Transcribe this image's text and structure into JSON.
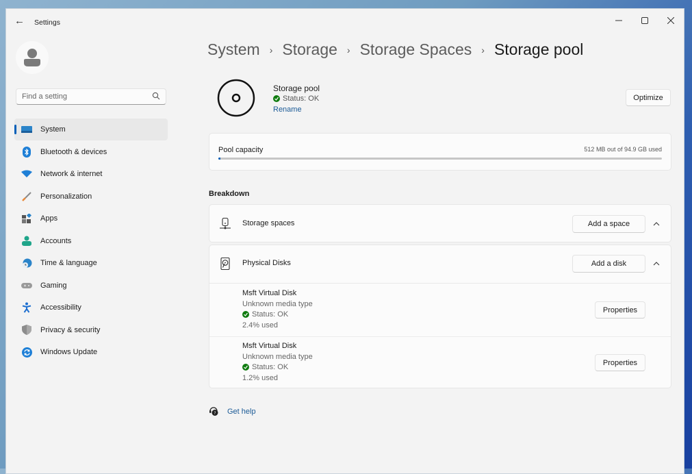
{
  "window": {
    "title": "Settings",
    "controls": {
      "minimize": "minimize",
      "maximize": "maximize",
      "close": "close"
    }
  },
  "search": {
    "placeholder": "Find a setting"
  },
  "sidebar": {
    "items": [
      {
        "label": "System",
        "icon": "system-icon",
        "active": true
      },
      {
        "label": "Bluetooth & devices",
        "icon": "bluetooth-icon"
      },
      {
        "label": "Network & internet",
        "icon": "wifi-icon"
      },
      {
        "label": "Personalization",
        "icon": "brush-icon"
      },
      {
        "label": "Apps",
        "icon": "apps-icon"
      },
      {
        "label": "Accounts",
        "icon": "person-icon"
      },
      {
        "label": "Time & language",
        "icon": "clock-globe-icon"
      },
      {
        "label": "Gaming",
        "icon": "controller-icon"
      },
      {
        "label": "Accessibility",
        "icon": "accessibility-icon"
      },
      {
        "label": "Privacy & security",
        "icon": "shield-icon"
      },
      {
        "label": "Windows Update",
        "icon": "update-icon"
      }
    ]
  },
  "breadcrumb": [
    "System",
    "Storage",
    "Storage Spaces",
    "Storage pool"
  ],
  "pool": {
    "name": "Storage pool",
    "status": "Status: OK",
    "rename": "Rename",
    "optimize": "Optimize"
  },
  "capacity": {
    "label": "Pool capacity",
    "value": "512 MB out of 94.9 GB used",
    "fraction_used": 0.0053
  },
  "breakdown": {
    "title": "Breakdown",
    "storage_spaces": {
      "label": "Storage spaces",
      "button": "Add a space"
    },
    "physical_disks": {
      "label": "Physical Disks",
      "button": "Add a disk",
      "disks": [
        {
          "name": "Msft Virtual Disk",
          "media": "Unknown media type",
          "status": "Status: OK",
          "used": "2.4% used",
          "button": "Properties"
        },
        {
          "name": "Msft Virtual Disk",
          "media": "Unknown media type",
          "status": "Status: OK",
          "used": "1.2% used",
          "button": "Properties"
        }
      ]
    }
  },
  "help": {
    "label": "Get help"
  },
  "colors": {
    "accent": "#005fb8",
    "ok": "#0f7b0f",
    "link": "#1a5a96"
  }
}
